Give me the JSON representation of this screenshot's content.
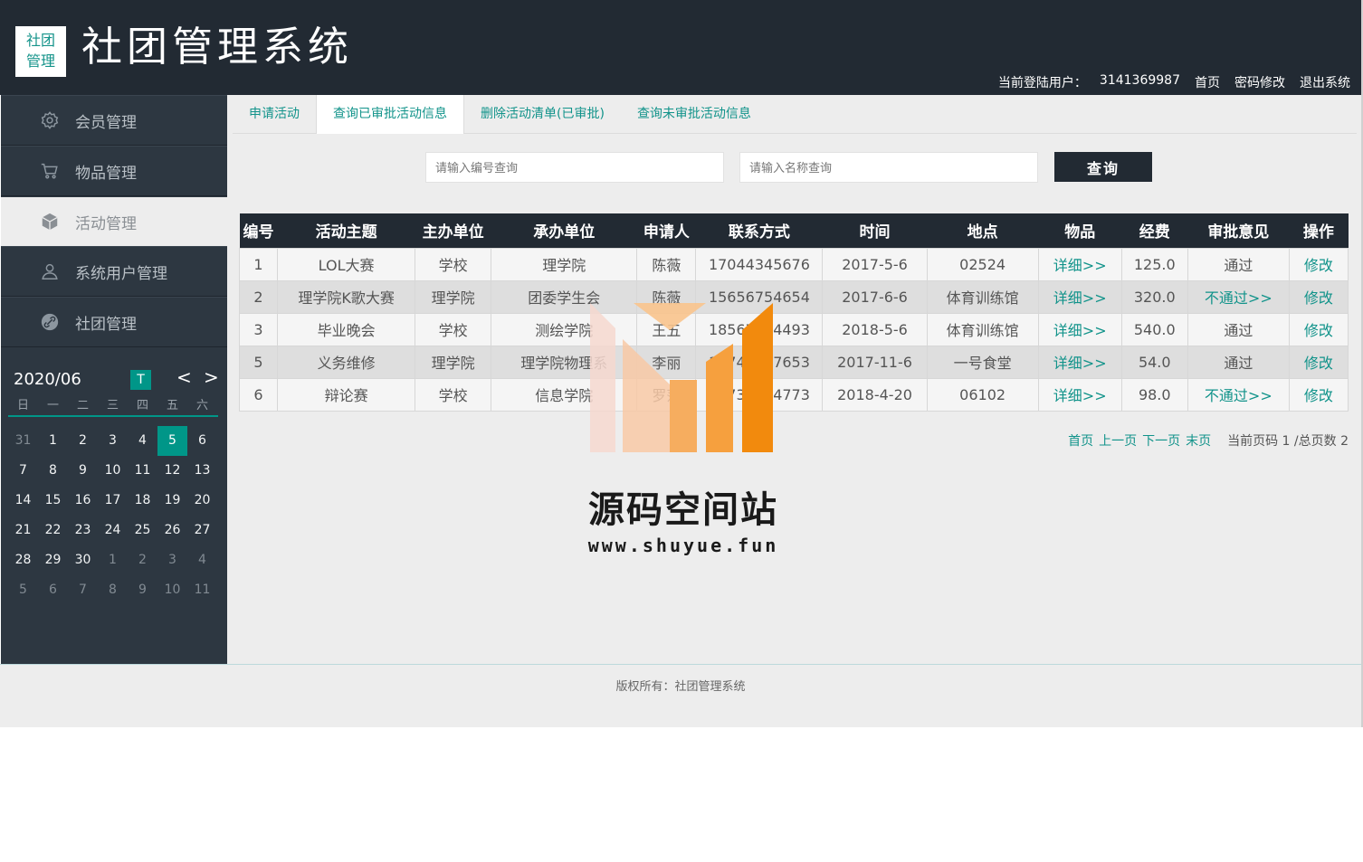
{
  "header": {
    "logo_text": "社团管理",
    "logo_line1": "社团",
    "logo_line2": "管理",
    "title": "社团管理系统",
    "user_label": "当前登陆用户：",
    "user_id": "3141369987",
    "links": [
      "首页",
      "密码修改",
      "退出系统"
    ]
  },
  "sidebar": {
    "items": [
      {
        "label": "会员管理",
        "icon": "gear-icon"
      },
      {
        "label": "物品管理",
        "icon": "cart-icon"
      },
      {
        "label": "活动管理",
        "icon": "cube-icon"
      },
      {
        "label": "系统用户管理",
        "icon": "user-icon"
      },
      {
        "label": "社团管理",
        "icon": "link-circle-icon"
      }
    ],
    "active_index": 2
  },
  "calendar": {
    "month": "2020/06",
    "today_label": "T",
    "prev": "<",
    "next": ">",
    "weekdays": [
      "日",
      "一",
      "二",
      "三",
      "四",
      "五",
      "六"
    ],
    "days": [
      {
        "d": "31",
        "other": true
      },
      {
        "d": "1"
      },
      {
        "d": "2"
      },
      {
        "d": "3"
      },
      {
        "d": "4"
      },
      {
        "d": "5",
        "sel": true
      },
      {
        "d": "6"
      },
      {
        "d": "7"
      },
      {
        "d": "8"
      },
      {
        "d": "9"
      },
      {
        "d": "10"
      },
      {
        "d": "11"
      },
      {
        "d": "12"
      },
      {
        "d": "13"
      },
      {
        "d": "14"
      },
      {
        "d": "15"
      },
      {
        "d": "16"
      },
      {
        "d": "17"
      },
      {
        "d": "18"
      },
      {
        "d": "19"
      },
      {
        "d": "20"
      },
      {
        "d": "21"
      },
      {
        "d": "22"
      },
      {
        "d": "23"
      },
      {
        "d": "24"
      },
      {
        "d": "25"
      },
      {
        "d": "26"
      },
      {
        "d": "27"
      },
      {
        "d": "28"
      },
      {
        "d": "29"
      },
      {
        "d": "30"
      },
      {
        "d": "1",
        "other": true
      },
      {
        "d": "2",
        "other": true
      },
      {
        "d": "3",
        "other": true
      },
      {
        "d": "4",
        "other": true
      },
      {
        "d": "5",
        "other": true
      },
      {
        "d": "6",
        "other": true
      },
      {
        "d": "7",
        "other": true
      },
      {
        "d": "8",
        "other": true
      },
      {
        "d": "9",
        "other": true
      },
      {
        "d": "10",
        "other": true
      },
      {
        "d": "11",
        "other": true
      }
    ]
  },
  "tabs": [
    "申请活动",
    "查询已审批活动信息",
    "删除活动清单(已审批)",
    "查询未审批活动信息"
  ],
  "active_tab": 1,
  "search": {
    "id_placeholder": "请输入编号查询",
    "name_placeholder": "请输入名称查询",
    "button": "查询"
  },
  "table": {
    "columns": [
      "编号",
      "活动主题",
      "主办单位",
      "承办单位",
      "申请人",
      "联系方式",
      "时间",
      "地点",
      "物品",
      "经费",
      "审批意见",
      "操作"
    ],
    "rows": [
      [
        "1",
        "LOL大赛",
        "学校",
        "理学院",
        "陈薇",
        "17044345676",
        "2017-5-6",
        "02524",
        "详细>>",
        "125.0",
        "通过",
        "修改"
      ],
      [
        "2",
        "理学院K歌大赛",
        "理学院",
        "团委学生会",
        "陈薇",
        "15656754654",
        "2017-6-6",
        "体育训练馆",
        "详细>>",
        "320.0",
        "不通过>>",
        "修改"
      ],
      [
        "3",
        "毕业晚会",
        "学校",
        "测绘学院",
        "王五",
        "18567754493",
        "2018-5-6",
        "体育训练馆",
        "详细>>",
        "540.0",
        "通过",
        "修改"
      ],
      [
        "5",
        "义务维修",
        "理学院",
        "理学院物理系",
        "李丽",
        "17746547653",
        "2017-11-6",
        "一号食堂",
        "详细>>",
        "54.0",
        "通过",
        "修改"
      ],
      [
        "6",
        "辩论赛",
        "学校",
        "信息学院",
        "罗莎",
        "13734654773",
        "2018-4-20",
        "06102",
        "详细>>",
        "98.0",
        "不通过>>",
        "修改"
      ]
    ]
  },
  "pager": {
    "first": "首页",
    "prev": "上一页",
    "next": "下一页",
    "last": "末页",
    "info": "当前页码 1 /总页数 2"
  },
  "watermark": {
    "name": "源码空间站",
    "url": "www.shuyue.fun"
  },
  "footer": {
    "copyright": "版权所有：社团管理系统"
  },
  "colors": {
    "dark": "#222a33",
    "sidebar": "#2d3741",
    "accent": "#009688",
    "link": "#11938a"
  }
}
